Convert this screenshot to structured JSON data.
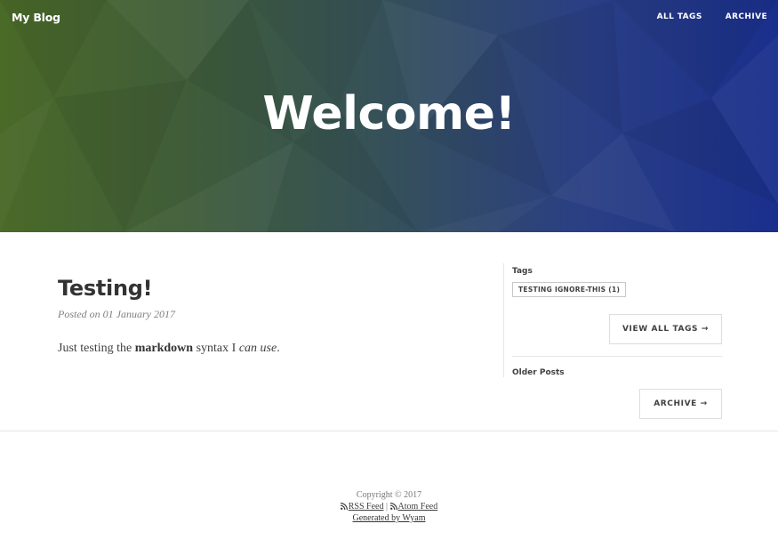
{
  "header": {
    "brand": "My Blog",
    "nav": [
      {
        "label": "ALL TAGS"
      },
      {
        "label": "ARCHIVE"
      }
    ],
    "title": "Welcome!",
    "gradient": {
      "left": "#4a6a28",
      "right": "#1a2f8c"
    }
  },
  "post": {
    "title": "Testing!",
    "meta": "Posted on 01 January 2017",
    "body": {
      "prefix": "Just testing the ",
      "bold": "markdown",
      "middle": " syntax I ",
      "italic": "can use",
      "suffix": "."
    }
  },
  "sidebar": {
    "tags_heading": "Tags",
    "tag": "TESTING IGNORE-THIS (1)",
    "view_all_tags": "VIEW ALL TAGS →",
    "older_heading": "Older Posts",
    "archive": "ARCHIVE →"
  },
  "footer": {
    "copyright": "Copyright © 2017",
    "rss": "RSS Feed",
    "separator": "|",
    "atom": "Atom Feed",
    "generated": "Generated by Wyam"
  },
  "icons": {
    "feed": "rss-icon"
  }
}
